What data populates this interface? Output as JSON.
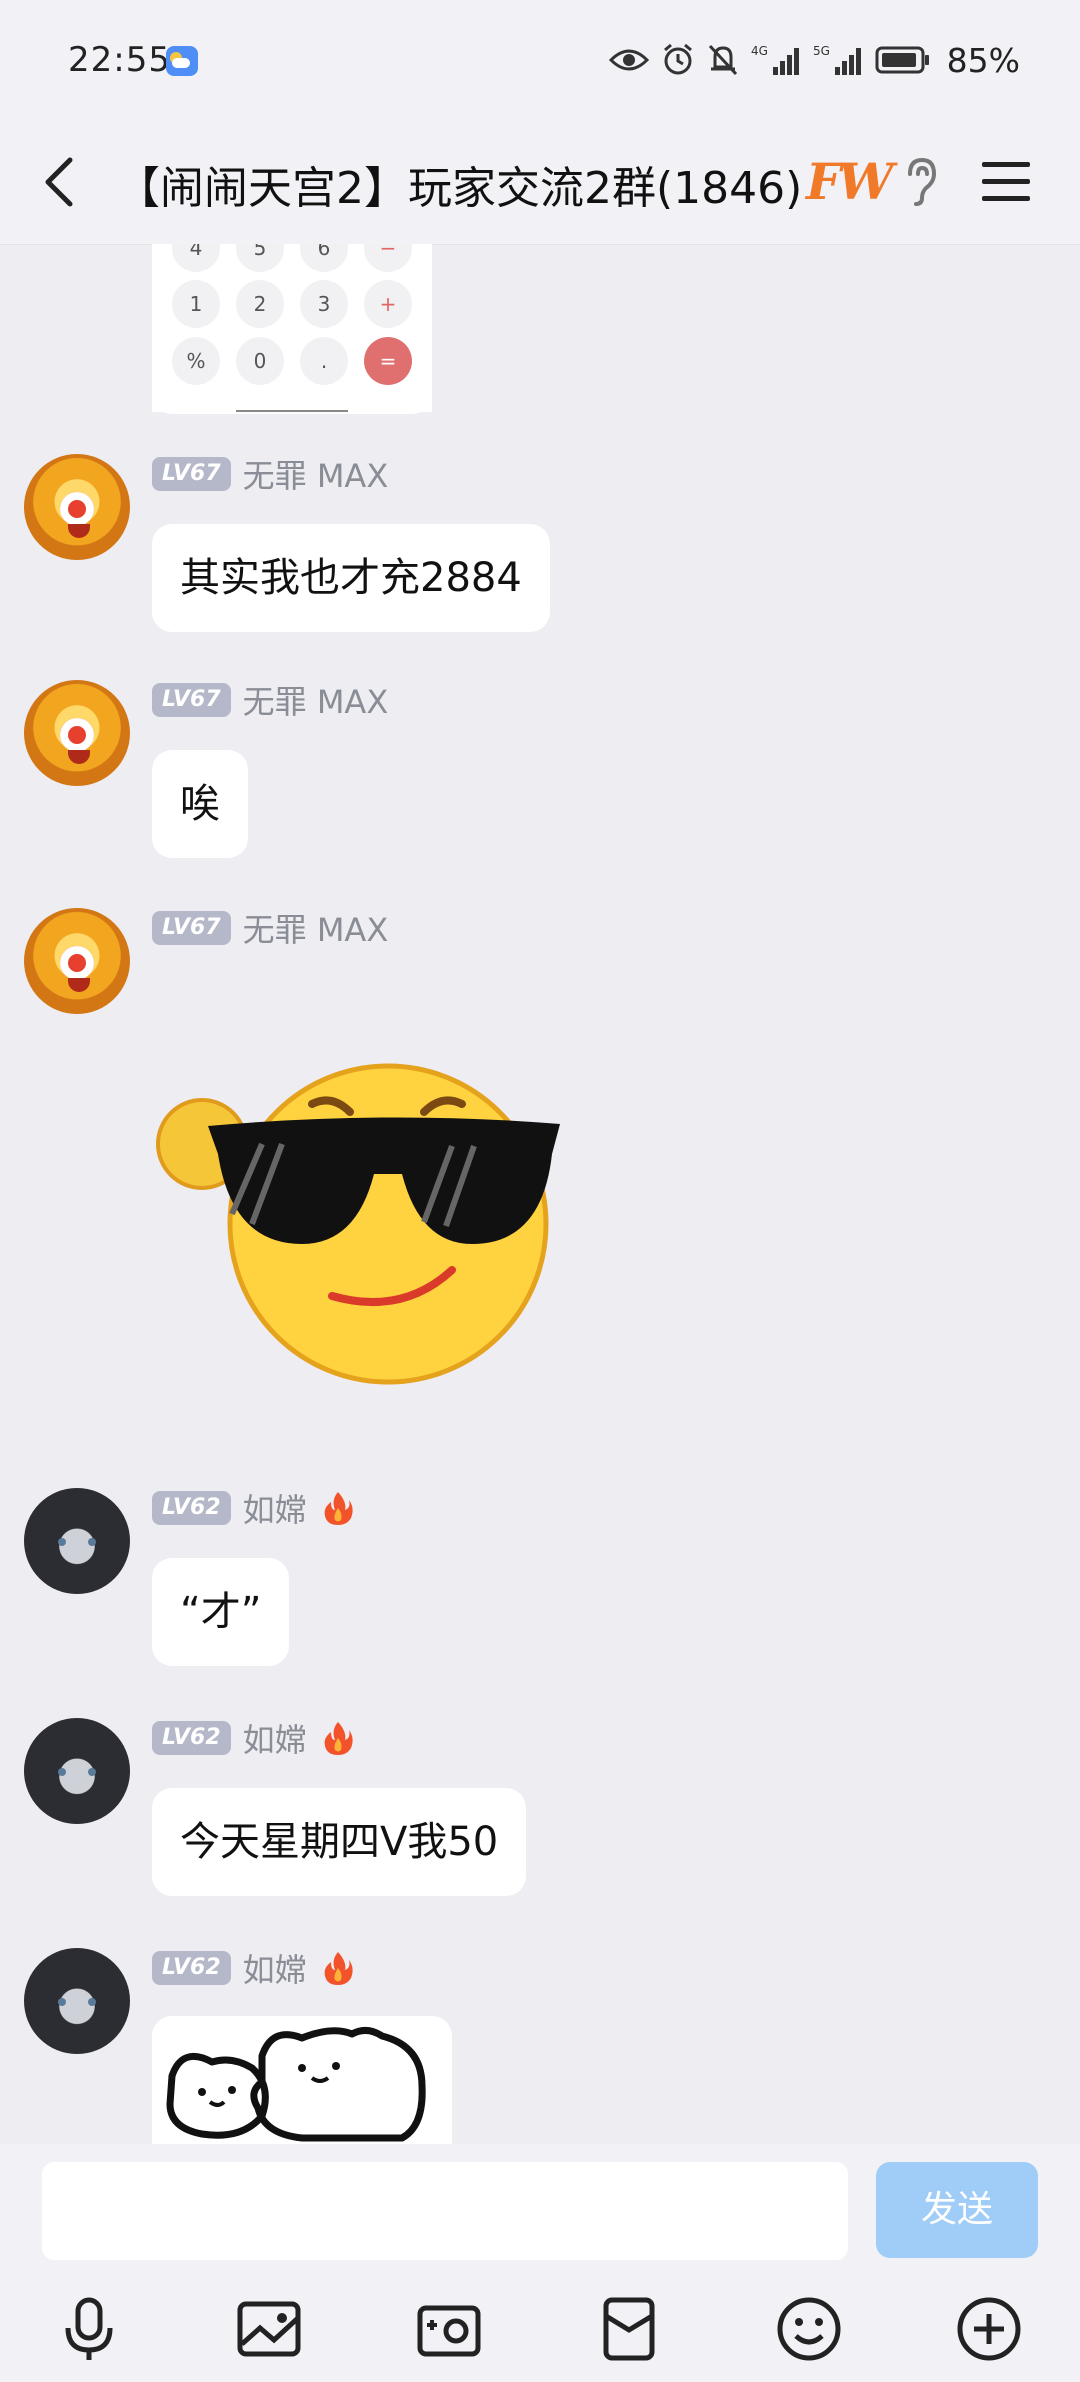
{
  "status_bar": {
    "time": "22:55",
    "battery_percent": "85%",
    "signal_1": "4G",
    "signal_2": "5G",
    "icons": [
      "weather-icon",
      "eye-icon",
      "alarm-icon",
      "mute-icon",
      "signal-4g-icon",
      "signal-5g-icon",
      "battery-icon"
    ]
  },
  "header": {
    "title": "【闹闹天宫2】玩家交流2群(1846)",
    "badge_text": "FW",
    "icons": [
      "back-arrow-icon",
      "earpiece-icon",
      "menu-icon"
    ]
  },
  "calculator_fragment": {
    "rows": [
      [
        "4",
        "5",
        "6",
        "−"
      ],
      [
        "1",
        "2",
        "3",
        "+"
      ],
      [
        "%",
        "0",
        ".",
        "="
      ]
    ]
  },
  "messages": [
    {
      "level": "LV67",
      "nickname": "无罪 MAX",
      "text": "其实我也才充2884"
    },
    {
      "level": "LV67",
      "nickname": "无罪 MAX",
      "text": "唉"
    },
    {
      "level": "LV67",
      "nickname": "无罪 MAX",
      "text": ""
    },
    {
      "level": "LV62",
      "nickname": "如嫦",
      "text": "“才”"
    },
    {
      "level": "LV62",
      "nickname": "如嫦",
      "text": "今天星期四V我50"
    },
    {
      "level": "LV62",
      "nickname": "如嫦",
      "text": ""
    }
  ],
  "input": {
    "placeholder": "",
    "send_label": "发送"
  },
  "toolbar": [
    "microphone-icon",
    "image-icon",
    "camera-icon",
    "red-packet-icon",
    "emoji-icon",
    "plus-icon"
  ],
  "colors": {
    "background": "#ededf2",
    "send_button": "#9fcdf7",
    "level_badge": "#b4b8c9",
    "badge_orange": "#f07a2a"
  }
}
